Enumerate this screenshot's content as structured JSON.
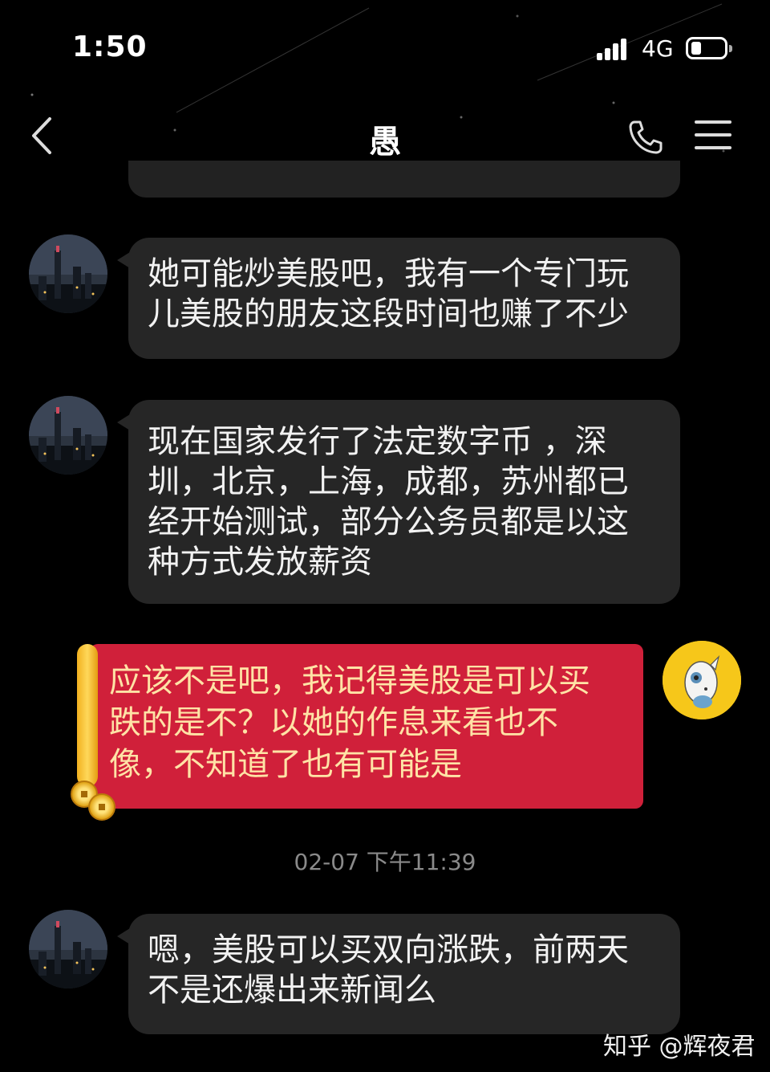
{
  "status_bar": {
    "time": "1:50",
    "network": "4G"
  },
  "nav": {
    "title": "愚"
  },
  "messages": [
    {
      "lines": [
        "她可能炒美股吧，我有一个专门玩",
        "儿美股的朋友这段时间也赚了不少"
      ]
    },
    {
      "lines": [
        "现在国家发行了法定数字币 ，深",
        "圳，北京，上海，成都，苏州都已",
        "经开始测试，部分公务员都是以这",
        "种方式发放薪资"
      ]
    },
    {
      "lines": [
        "应该不是吧，我记得美股是可以买",
        "跌的是不？以她的作息来看也不",
        "像，不知道了也有可能是"
      ]
    },
    {
      "lines": [
        "嗯，美股可以买双向涨跌，前两天",
        "不是还爆出来新闻么"
      ]
    }
  ],
  "timestamp": "02-07 下午11:39",
  "watermark": "知乎 @辉夜君",
  "colors": {
    "background": "#000000",
    "incoming_bubble": "#262626",
    "outgoing_bubble": "#d0203a",
    "outgoing_text": "#ffe3a6"
  }
}
